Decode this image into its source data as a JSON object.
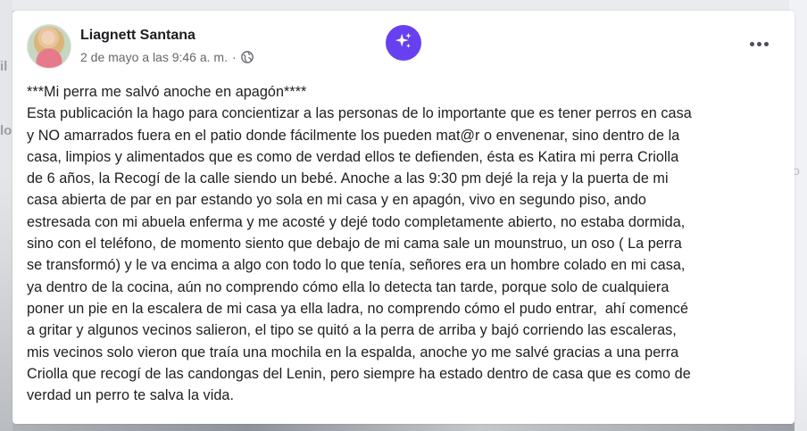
{
  "post": {
    "author": "Liagnett Santana",
    "timestamp": "2 de mayo a las 9:46 a. m.",
    "separator": "·",
    "audience_icon": "globe-icon",
    "ai_icon": "sparkle-icon",
    "more_icon": "ellipsis-icon",
    "text": "***Mi perra me salvó anoche en apagón****\nEsta publicación la hago para concientizar a las personas de lo importante que es tener perros en casa\ny NO amarrados fuera en el patio donde fácilmente los pueden mat@r o envenenar, sino dentro de la\ncasa, limpios y alimentados que es como de verdad ellos te defienden, ésta es Katira mi perra Criolla\nde 6 años, la Recogí de la calle siendo un bebé. Anoche a las 9:30 pm dejé la reja y la puerta de mi\ncasa abierta de par en par estando yo sola en mi casa y en apagón, vivo en segundo piso, ando\nestresada con mi abuela enferma y me acosté y dejé todo completamente abierto, no estaba dormida,\nsino con el teléfono, de momento siento que debajo de mi cama sale un mounstruo, un oso ( La perra\nse transformó) y le va encima a algo con todo lo que tenía, señores era un hombre colado en mi casa,\nya dentro de la cocina, aún no comprendo cómo ella lo detecta tan tarde, porque solo de cualquiera\nponer un pie en la escalera de mi casa ya ella ladra, no comprendo cómo el pudo entrar,  ahí comencé\na gritar y algunos vecinos salieron, el tipo se quitó a la perra de arriba y bajó corriendo las escaleras,\nmis vecinos solo vieron que traía una mochila en la espalda, anoche yo me salvé gracias a una perra\nCriolla que recogí de las candongas del Lenin, pero siempre ha estado dentro de casa que es como de\nverdad un perro te salva la vida."
  },
  "background": {
    "left_fragments": [
      "il",
      "lo"
    ],
    "right_fragments": [
      "o"
    ]
  },
  "colors": {
    "ai_button": "#6741f0",
    "text": "#1c1e21",
    "secondary_text": "#65676b"
  }
}
